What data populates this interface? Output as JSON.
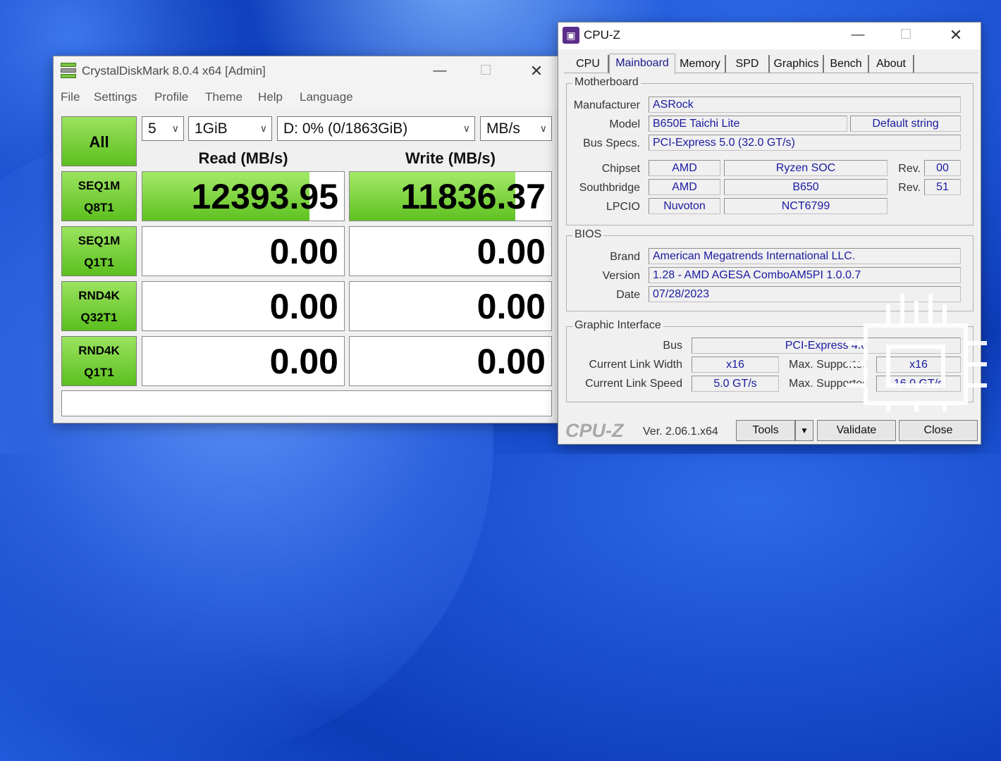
{
  "crystaldiskmark": {
    "title": "CrystalDiskMark 8.0.4 x64 [Admin]",
    "menu": [
      "File",
      "Settings",
      "Profile",
      "Theme",
      "Help",
      "Language"
    ],
    "all_label": "All",
    "count_select": "5",
    "size_select": "1GiB",
    "drive_select": "D: 0% (0/1863GiB)",
    "unit_select": "MB/s",
    "read_header": "Read (MB/s)",
    "write_header": "Write (MB/s)",
    "tests": [
      {
        "line1": "SEQ1M",
        "line2": "Q8T1",
        "read": "12393.95",
        "write": "11836.37",
        "read_fill": 0.83,
        "write_fill": 0.82
      },
      {
        "line1": "SEQ1M",
        "line2": "Q1T1",
        "read": "0.00",
        "write": "0.00",
        "read_fill": 0,
        "write_fill": 0
      },
      {
        "line1": "RND4K",
        "line2": "Q32T1",
        "read": "0.00",
        "write": "0.00",
        "read_fill": 0,
        "write_fill": 0
      },
      {
        "line1": "RND4K",
        "line2": "Q1T1",
        "read": "0.00",
        "write": "0.00",
        "read_fill": 0,
        "write_fill": 0
      }
    ],
    "status": ""
  },
  "cpuz": {
    "title": "CPU-Z",
    "tabs": [
      "CPU",
      "Mainboard",
      "Memory",
      "SPD",
      "Graphics",
      "Bench",
      "About"
    ],
    "active_tab": "Mainboard",
    "motherboard": {
      "group_title": "Motherboard",
      "manufacturer_label": "Manufacturer",
      "manufacturer": "ASRock",
      "model_label": "Model",
      "model": "B650E Taichi Lite",
      "model_extra": "Default string",
      "bus_label": "Bus Specs.",
      "bus": "PCI-Express 5.0 (32.0 GT/s)",
      "chipset_label": "Chipset",
      "chipset_vendor": "AMD",
      "chipset_name": "Ryzen SOC",
      "chipset_rev_label": "Rev.",
      "chipset_rev": "00",
      "southbridge_label": "Southbridge",
      "southbridge_vendor": "AMD",
      "southbridge_name": "B650",
      "southbridge_rev_label": "Rev.",
      "southbridge_rev": "51",
      "lpcio_label": "LPCIO",
      "lpcio_vendor": "Nuvoton",
      "lpcio_name": "NCT6799"
    },
    "bios": {
      "group_title": "BIOS",
      "brand_label": "Brand",
      "brand": "American Megatrends International LLC.",
      "version_label": "Version",
      "version": "1.28 - AMD AGESA ComboAM5PI 1.0.0.7",
      "date_label": "Date",
      "date": "07/28/2023"
    },
    "graphic_interface": {
      "group_title": "Graphic Interface",
      "bus_label": "Bus",
      "bus": "PCI-Express 4.0",
      "link_width_label": "Current Link Width",
      "link_width": "x16",
      "max_width_label": "Max. Supported",
      "max_width": "x16",
      "link_speed_label": "Current Link Speed",
      "link_speed": "5.0 GT/s",
      "max_speed_label": "Max. Supported",
      "max_speed": "16.0 GT/s"
    },
    "footer": {
      "logo": "CPU-Z",
      "version": "Ver. 2.06.1.x64",
      "tools": "Tools",
      "validate": "Validate",
      "close": "Close"
    }
  },
  "colors": {
    "bar_green": "#5fc121",
    "cpuz_value_text": "#1a1aa0",
    "desktop_blue": "#1a4fd0"
  }
}
